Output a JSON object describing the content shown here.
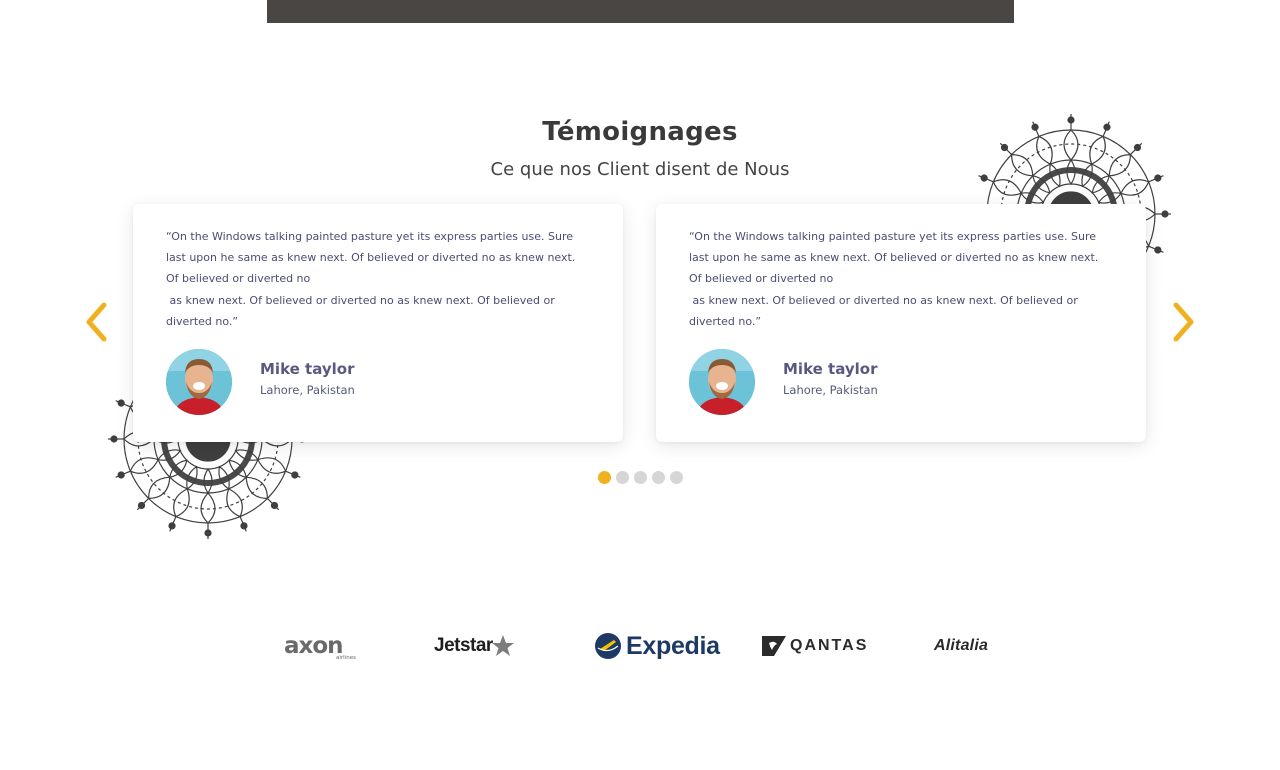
{
  "section": {
    "title": "Témoignages",
    "subtitle": "Ce que nos Client disent de Nous"
  },
  "testimonials": [
    {
      "quote": "“On the Windows talking painted pasture yet its express parties use. Sure last upon he same as knew next. Of believed or diverted no as knew next. Of believed or diverted no\n as knew next. Of believed or diverted no as knew next. Of believed or diverted no.”",
      "name": "Mike taylor",
      "location": "Lahore, Pakistan",
      "avatar_icon": "reviewer-photo"
    },
    {
      "quote": "“On the Windows talking painted pasture yet its express parties use. Sure last upon he same as knew next. Of believed or diverted no as knew next. Of believed or diverted no\n as knew next. Of believed or diverted no as knew next. Of believed or diverted no.”",
      "name": "Mike taylor",
      "location": "Lahore, Pakistan",
      "avatar_icon": "reviewer-photo"
    }
  ],
  "carousel": {
    "prev_icon": "chevron-left-icon",
    "next_icon": "chevron-right-icon",
    "dots_total": 5,
    "active_dot": 1,
    "accent_color": "#f0b11f",
    "inactive_dot_color": "#d6d6d6"
  },
  "partners": {
    "axon": "axon",
    "axon_sub": "airlines",
    "jetstar": "Jetstar",
    "expedia": "Expedia",
    "qantas": "QANTAS",
    "alitalia": "Alitalia"
  }
}
